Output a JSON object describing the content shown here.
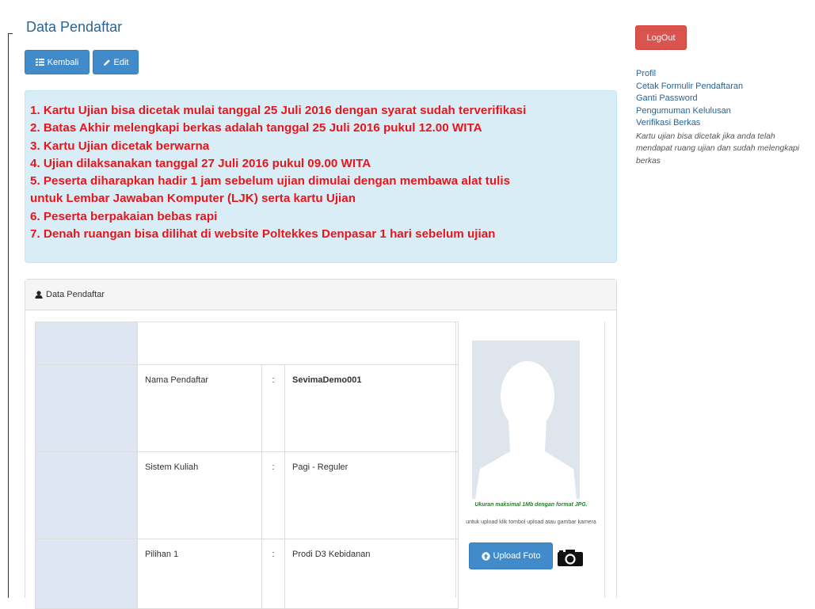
{
  "page": {
    "title": "Data Pendaftar"
  },
  "toolbar": {
    "back_label": "Kembali",
    "edit_label": "Edit"
  },
  "notice": {
    "color": "#e8161c",
    "lines": [
      "1. Kartu Ujian bisa dicetak mulai tanggal 25 Juli 2016 dengan syarat sudah terverifikasi",
      "2. Batas Akhir melengkapi berkas adalah tanggal 25 Juli 2016 pukul 12.00 WITA",
      "3. Kartu Ujian dicetak berwarna",
      "4. Ujian dilaksanakan tanggal 27 Juli 2016 pukul 09.00 WITA",
      "5. Peserta diharapkan hadir 1 jam sebelum ujian dimulai dengan membawa alat tulis",
      "untuk Lembar Jawaban Komputer (LJK) serta kartu Ujian",
      "6. Peserta berpakaian bebas rapi",
      "7. Denah ruangan bisa dilihat di website Poltekkes Denpasar 1 hari sebelum ujian"
    ]
  },
  "panel": {
    "heading": "Data Pendaftar",
    "rows": [
      {
        "label": "Nama Pendaftar",
        "sep": ":",
        "value": "SevimaDemo001"
      },
      {
        "label": "Sistem Kuliah",
        "sep": ":",
        "value": "Pagi - Reguler"
      },
      {
        "label": "Pilihan 1",
        "sep": ":",
        "value": "Prodi D3 Kebidanan"
      }
    ]
  },
  "photo": {
    "size_note": "Ukuran maksimal 1Mb dengan format JPG.",
    "upload_note": "untuk upload klik tombol upload atau gambar kamera",
    "upload_label": "Upload Foto"
  },
  "sidebar": {
    "logout_label": "LogOut",
    "links": [
      "Profil",
      "Cetak Formulir Pendaftaran",
      "Ganti Password",
      "Pengumuman Kelulusan",
      "Verifikasi Berkas"
    ],
    "note": "Kartu ujian bisa dicetak jika anda telah mendapat ruang ujian dan sudah melengkapi berkas"
  },
  "colors": {
    "primary": "#428bca",
    "danger": "#d9534f",
    "alert_bg": "#d9edf7",
    "link": "#2a6496"
  },
  "icons": [
    "list-icon",
    "pencil-icon",
    "user-icon",
    "upload-circle-icon",
    "camera-icon"
  ]
}
